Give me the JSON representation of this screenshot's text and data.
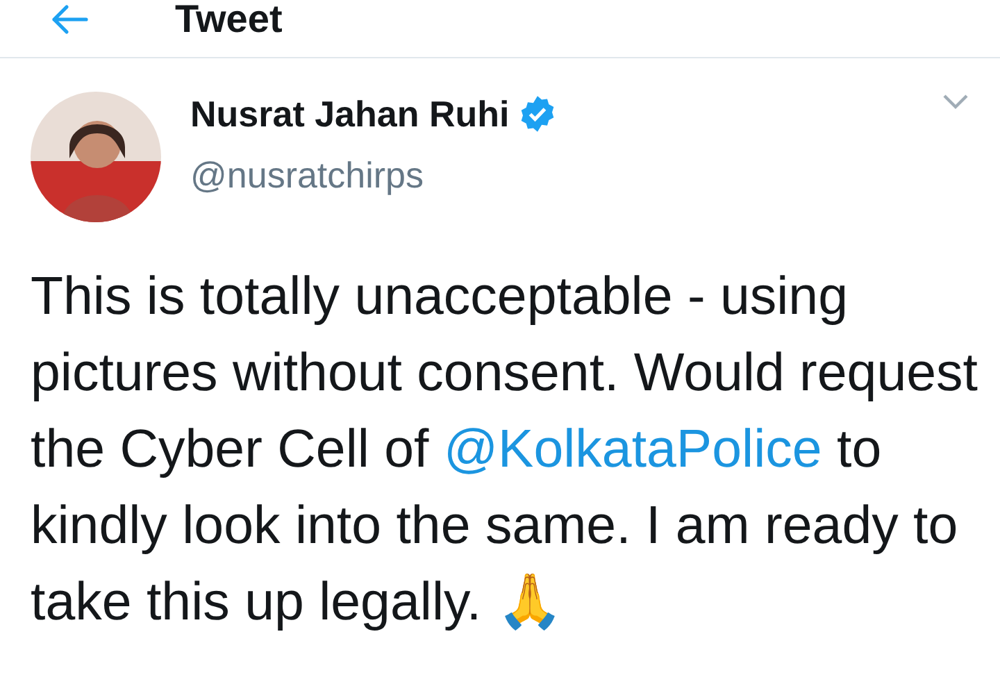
{
  "header": {
    "title": "Tweet"
  },
  "tweet": {
    "author": {
      "name": "Nusrat Jahan Ruhi",
      "handle": "@nusratchirps",
      "verified": true
    },
    "body": [
      {
        "kind": "text",
        "text": "This is totally unacceptable - using pictures without consent. Would request the Cyber Cell of "
      },
      {
        "kind": "mention",
        "text": "@KolkataPolice"
      },
      {
        "kind": "text",
        "text": " to kindly look into the same. I am ready to take this up legally. 🙏"
      }
    ]
  }
}
